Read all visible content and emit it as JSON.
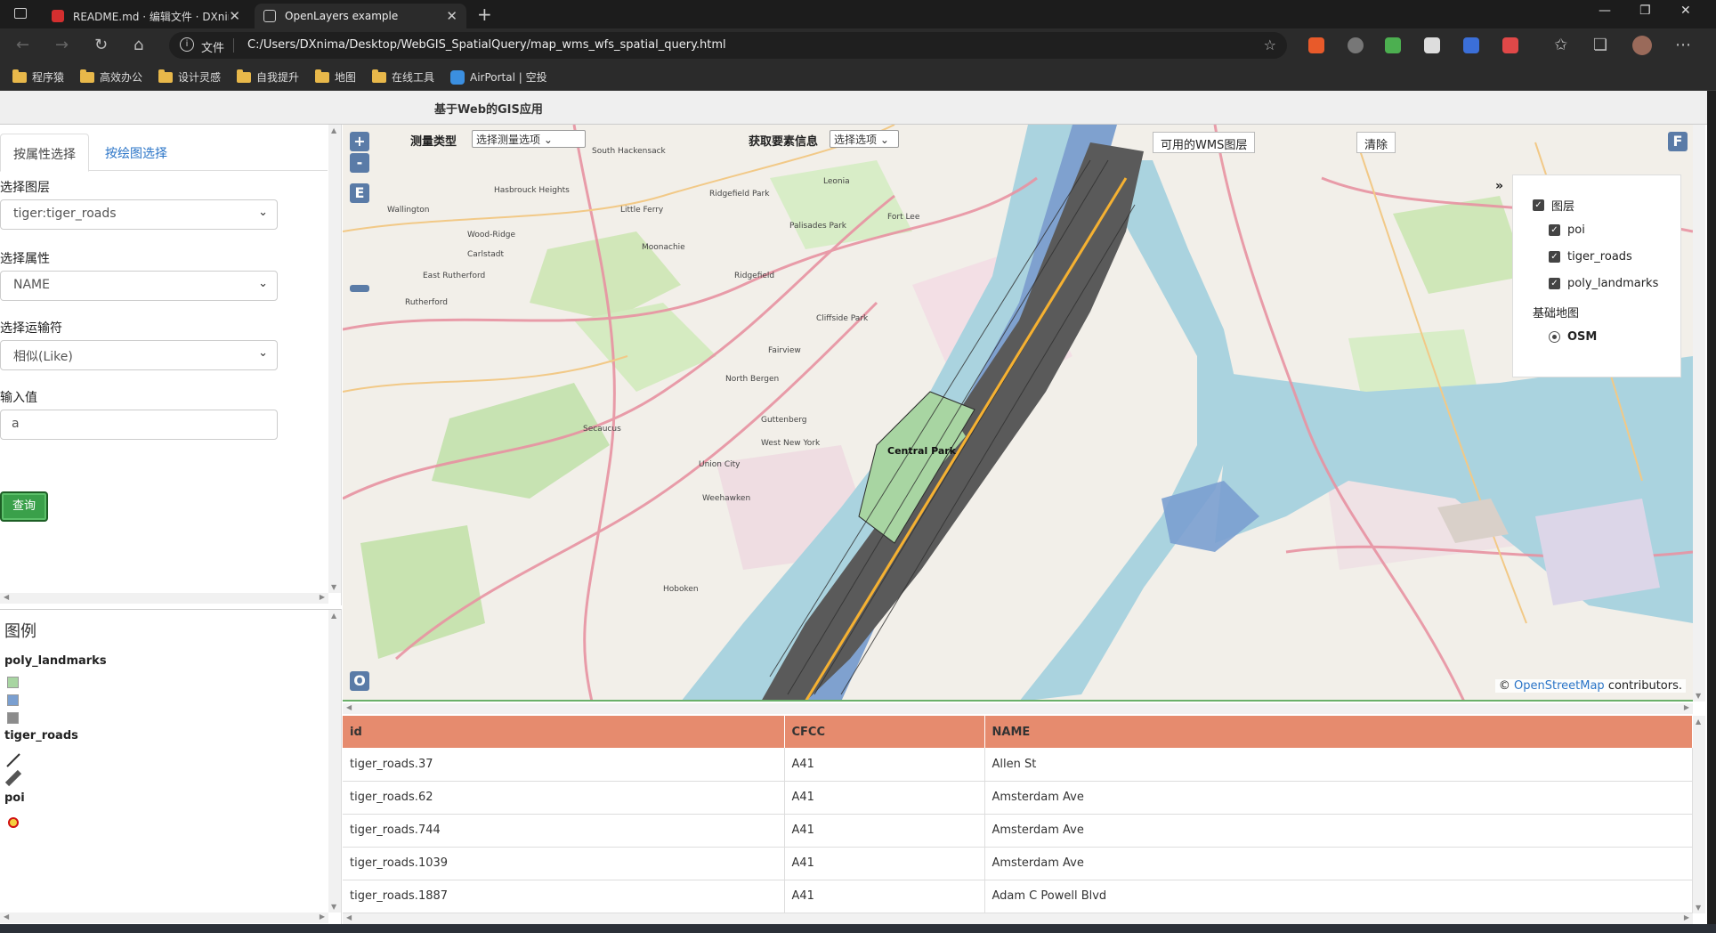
{
  "browser": {
    "tabs": [
      {
        "title": "README.md · 编辑文件 · DXnima",
        "active": false
      },
      {
        "title": "OpenLayers example",
        "active": true
      }
    ],
    "address": {
      "scheme": "文件",
      "url": "C:/Users/DXnima/Desktop/WebGIS_SpatialQuery/map_wms_wfs_spatial_query.html"
    },
    "bookmarks": [
      "程序猿",
      "高效办公",
      "设计灵感",
      "自我提升",
      "地图",
      "在线工具",
      "AirPortal | 空投"
    ]
  },
  "app": {
    "title": "基于Web的GIS应用"
  },
  "left_panel": {
    "tabs": [
      "按属性选择",
      "按绘图选择"
    ],
    "layer_label": "选择图层",
    "layer_value": "tiger:tiger_roads",
    "attr_label": "选择属性",
    "attr_value": "NAME",
    "op_label": "选择运输符",
    "op_value": "相似(Like)",
    "input_label": "输入值",
    "input_value": "a",
    "query_button": "查询"
  },
  "legend": {
    "title": "图例",
    "poly_landmarks": "poly_landmarks",
    "tiger_roads": "tiger_roads",
    "poi": "poi",
    "swatch_colors": [
      "#a8d5a2",
      "#7a9fd0",
      "#8c8c8c"
    ]
  },
  "map": {
    "zoom_in": "+",
    "zoom_out": "-",
    "e_button": "E",
    "o_button": "O",
    "f_button": "F",
    "measure_label": "测量类型",
    "measure_select": "选择测量选项",
    "feature_label": "获取要素信息",
    "feature_select": "选择选项",
    "wms_button": "可用的WMS图层",
    "clear_button": "清除",
    "collapse": "»",
    "layers_header": "图层",
    "layers": [
      "poi",
      "tiger_roads",
      "poly_landmarks"
    ],
    "basemap_header": "基础地图",
    "basemap": "OSM",
    "attribution_prefix": "©",
    "attribution_link": "OpenStreetMap",
    "attribution_suffix": "contributors.",
    "place_labels": [
      "Central Park",
      "Ridgefield Park",
      "Little Ferry",
      "Palisades Park",
      "Fort Lee",
      "Leonia",
      "Ridgefield",
      "Rutherford",
      "North Bergen",
      "Secaucus",
      "West New York",
      "Union City",
      "Guttenberg",
      "Weehawken",
      "Hoboken",
      "Cliffside Park",
      "Fairview",
      "Hasbrouck Heights",
      "Wallington",
      "Wood-Ridge",
      "Carlstadt",
      "East Rutherford",
      "Moonachie",
      "South Hackensack"
    ]
  },
  "table": {
    "columns": [
      "id",
      "CFCC",
      "NAME"
    ],
    "rows": [
      [
        "tiger_roads.37",
        "A41",
        "Allen St"
      ],
      [
        "tiger_roads.62",
        "A41",
        "Amsterdam Ave"
      ],
      [
        "tiger_roads.744",
        "A41",
        "Amsterdam Ave"
      ],
      [
        "tiger_roads.1039",
        "A41",
        "Amsterdam Ave"
      ],
      [
        "tiger_roads.1887",
        "A41",
        "Adam C Powell Blvd"
      ]
    ]
  }
}
